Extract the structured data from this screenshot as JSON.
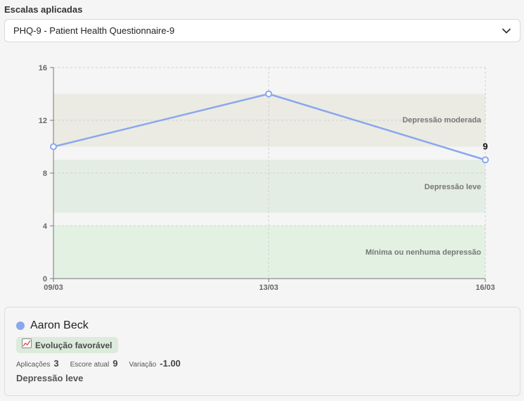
{
  "scales": {
    "title": "Escalas aplicadas",
    "selected": "PHQ-9 - Patient Health Questionnaire-9"
  },
  "chart_data": {
    "type": "line",
    "x": [
      "09/03",
      "13/03",
      "16/03"
    ],
    "series": [
      {
        "values": [
          10,
          14,
          9
        ],
        "color": "#8aa7ee"
      }
    ],
    "ylim": [
      0,
      16
    ],
    "yticks": [
      "0",
      "4",
      "8",
      "12",
      "16"
    ],
    "grid": true,
    "last_point_label": "9",
    "bands": [
      {
        "label": "Depressão moderada",
        "from": 10,
        "to": 14,
        "color": "#ebebe4"
      },
      {
        "label": "Depressão leve",
        "from": 5,
        "to": 9,
        "color": "#e4ede4"
      },
      {
        "label": "Mínima ou nenhuma depressão",
        "from": 0,
        "to": 4,
        "color": "#e3f1e3"
      }
    ]
  },
  "card": {
    "patient_name": "Aaron Beck",
    "dot_color": "#8aa7ee",
    "badge": {
      "icon": "chart-increasing-icon",
      "label": "Evolução favorável"
    },
    "stats": {
      "applications_label": "Aplicações",
      "applications_value": "3",
      "current_label": "Escore atual",
      "current_value": "9",
      "variation_label": "Variação",
      "variation_value": "-1.00"
    },
    "classification": "Depressão leve"
  }
}
